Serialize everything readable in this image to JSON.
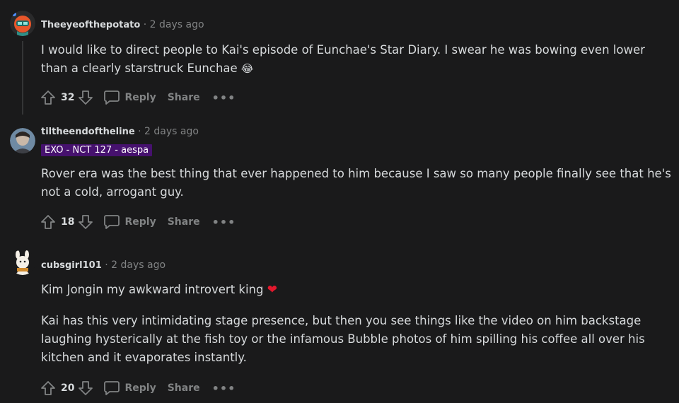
{
  "comments": [
    {
      "author": "Theeyeofthepotato",
      "time": "· 2 days ago",
      "flair": "",
      "paragraphs": [
        "I would like to direct people to Kai's episode of Eunchae's Star Diary. I swear he was bowing even lower than a clearly starstruck Eunchae"
      ],
      "emoji": "😂",
      "score": "32",
      "reply_label": "Reply",
      "share_label": "Share",
      "more_label": "•••"
    },
    {
      "author": "tiltheendoftheline",
      "time": "· 2 days ago",
      "flair": "EXO - NCT 127 - aespa",
      "paragraphs": [
        "Rover era was the best thing that ever happened to him because I saw so many people finally see that he's not a cold, arrogant guy."
      ],
      "score": "18",
      "reply_label": "Reply",
      "share_label": "Share",
      "more_label": "•••"
    },
    {
      "author": "cubsgirl101",
      "time": "· 2 days ago",
      "flair": "",
      "paragraphs": [
        "Kim Jongin my awkward introvert king",
        "Kai has this very intimidating stage presence, but then you see things like the video on him backstage laughing hysterically at the fish toy or the infamous Bubble photos of him spilling his coffee all over his kitchen and it evaporates instantly."
      ],
      "emoji": "❤",
      "score": "20",
      "reply_label": "Reply",
      "share_label": "Share",
      "more_label": "•••"
    }
  ],
  "colors": {
    "background": "#1a1a1b",
    "text": "#d7dadc",
    "muted": "#818384",
    "flair_bg": "#46116e",
    "heart": "#e3182d"
  }
}
